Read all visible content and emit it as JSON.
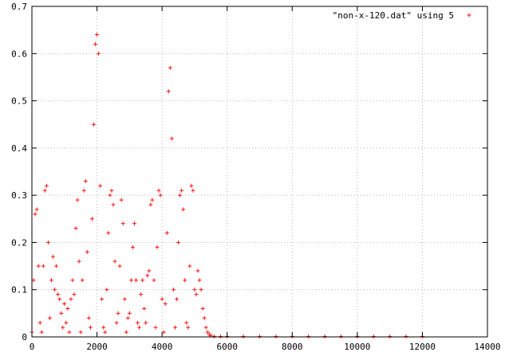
{
  "chart_data": {
    "type": "scatter",
    "title": "",
    "xlabel": "",
    "ylabel": "",
    "xlim": [
      0,
      14000
    ],
    "ylim": [
      0,
      0.7
    ],
    "x_ticks": [
      0,
      2000,
      4000,
      6000,
      8000,
      10000,
      12000,
      14000
    ],
    "x_tick_labels": [
      "0",
      "2000",
      "4000",
      "6000",
      "8000",
      "10000",
      "12000",
      "14000"
    ],
    "y_ticks": [
      0,
      0.1,
      0.2,
      0.3,
      0.4,
      0.5,
      0.6,
      0.7
    ],
    "y_tick_labels": [
      "0",
      "0.1",
      "0.2",
      "0.3",
      "0.4",
      "0.5",
      "0.6",
      "0.7"
    ],
    "grid": true,
    "legend": "top-right",
    "marker": "plus",
    "color": "#ff0000",
    "series": [
      {
        "name": "\"non-x-120.dat\" using 5",
        "x": [
          0,
          50,
          100,
          150,
          200,
          250,
          300,
          350,
          400,
          450,
          500,
          550,
          600,
          650,
          700,
          750,
          800,
          850,
          900,
          950,
          1000,
          1050,
          1100,
          1150,
          1200,
          1250,
          1300,
          1350,
          1400,
          1450,
          1500,
          1550,
          1600,
          1650,
          1700,
          1750,
          1800,
          1850,
          1900,
          1950,
          2000,
          2050,
          2100,
          2150,
          2200,
          2250,
          2300,
          2350,
          2400,
          2450,
          2500,
          2550,
          2600,
          2650,
          2700,
          2750,
          2800,
          2850,
          2900,
          2950,
          3000,
          3050,
          3100,
          3150,
          3200,
          3250,
          3300,
          3350,
          3400,
          3450,
          3500,
          3550,
          3600,
          3650,
          3700,
          3750,
          3800,
          3850,
          3900,
          3950,
          4000,
          4050,
          4100,
          4150,
          4200,
          4250,
          4300,
          4350,
          4400,
          4450,
          4500,
          4550,
          4600,
          4650,
          4700,
          4750,
          4800,
          4850,
          4900,
          4950,
          5000,
          5050,
          5100,
          5150,
          5200,
          5250,
          5300,
          5350,
          5400,
          5450,
          5500,
          5600,
          5800,
          6000,
          6500,
          7000,
          7500,
          8000,
          8500,
          9000,
          9500,
          10000,
          10500,
          11000,
          11500,
          12000
        ],
        "y": [
          0.01,
          0.12,
          0.26,
          0.27,
          0.15,
          0.03,
          0.01,
          0.15,
          0.31,
          0.32,
          0.2,
          0.04,
          0.12,
          0.17,
          0.1,
          0.15,
          0.09,
          0.08,
          0.05,
          0.02,
          0.07,
          0.03,
          0.06,
          0.01,
          0.08,
          0.12,
          0.09,
          0.23,
          0.29,
          0.16,
          0.01,
          0.12,
          0.31,
          0.33,
          0.18,
          0.04,
          0.02,
          0.25,
          0.45,
          0.62,
          0.64,
          0.6,
          0.32,
          0.08,
          0.02,
          0.01,
          0.1,
          0.22,
          0.3,
          0.31,
          0.28,
          0.16,
          0.03,
          0.05,
          0.15,
          0.29,
          0.24,
          0.08,
          0.01,
          0.04,
          0.05,
          0.12,
          0.19,
          0.24,
          0.12,
          0.03,
          0.02,
          0.09,
          0.12,
          0.06,
          0.03,
          0.13,
          0.14,
          0.28,
          0.29,
          0.12,
          0.02,
          0.19,
          0.31,
          0.3,
          0.08,
          0.01,
          0.07,
          0.22,
          0.52,
          0.57,
          0.42,
          0.1,
          0.02,
          0.08,
          0.2,
          0.3,
          0.31,
          0.27,
          0.12,
          0.03,
          0.02,
          0.15,
          0.32,
          0.31,
          0.1,
          0.09,
          0.14,
          0.12,
          0.1,
          0.06,
          0.04,
          0.02,
          0.01,
          0.005,
          0.003,
          0.001,
          0.001,
          0.001,
          0.001,
          0.001,
          0.001,
          0.001,
          0.001,
          0.001,
          0.001,
          0.001,
          0.001,
          0.001,
          0.001,
          0.001
        ]
      }
    ]
  }
}
